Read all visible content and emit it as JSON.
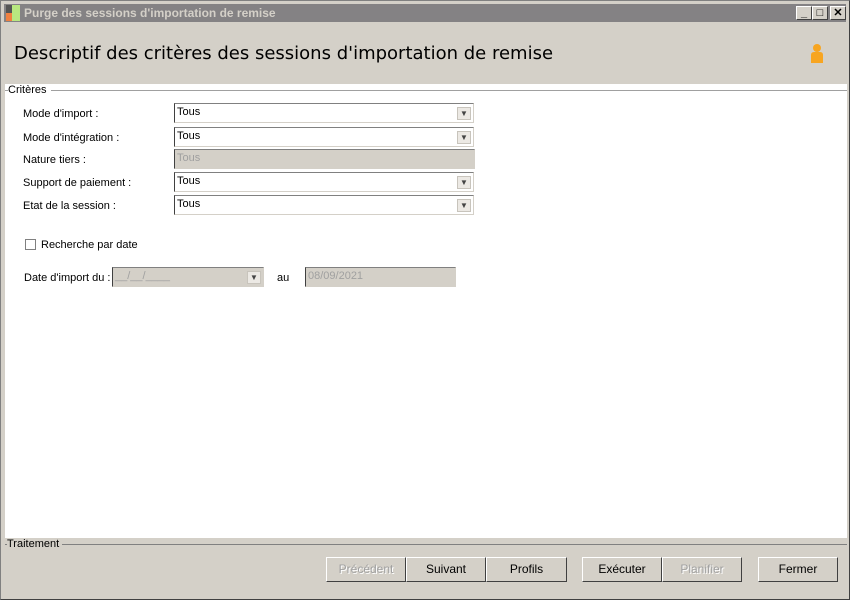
{
  "window": {
    "title": "Purge des sessions d'importation de remise",
    "minimize": "_",
    "maximize": "□",
    "close": "✕"
  },
  "header": {
    "title": "Descriptif des critères des sessions d'importation de remise",
    "icon": "user-icon"
  },
  "criteria": {
    "legend": "Critères",
    "fields": [
      {
        "label": "Mode d'import :",
        "value": "Tous",
        "enabled": true
      },
      {
        "label": "Mode d'intégration :",
        "value": "Tous",
        "enabled": true
      },
      {
        "label": "Nature tiers :",
        "value": "Tous",
        "enabled": false
      },
      {
        "label": "Support de paiement :",
        "value": "Tous",
        "enabled": true
      },
      {
        "label": "Etat de la session :",
        "value": "Tous",
        "enabled": true
      }
    ],
    "date_search": {
      "label": "Recherche par date",
      "checked": false
    },
    "date_from": {
      "label": "Date d'import du :",
      "value": "__/__/____"
    },
    "date_to": {
      "label": "au",
      "value": "08/09/2021"
    }
  },
  "treatment": {
    "legend": "Traitement",
    "buttons": {
      "previous": "Précédent",
      "next": "Suivant",
      "profiles": "Profils",
      "execute": "Exécuter",
      "schedule": "Planifier",
      "close": "Fermer"
    }
  },
  "colors": {
    "titlebar": "#848284",
    "face": "#d4d0c8",
    "user_icon": "#f7a521"
  }
}
